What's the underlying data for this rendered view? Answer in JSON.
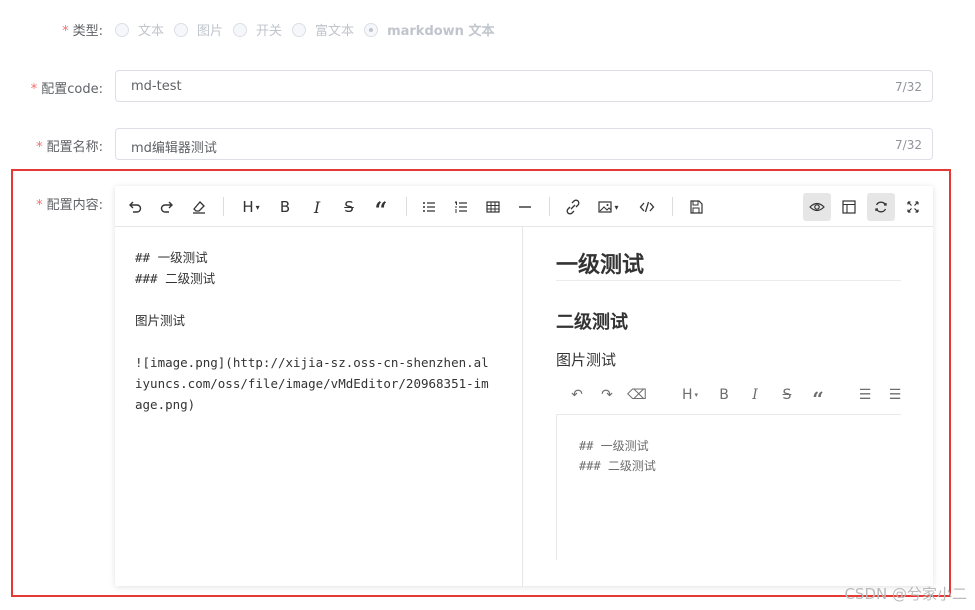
{
  "form": {
    "type_field": {
      "label": "类型:",
      "required_mark": "*",
      "options": [
        {
          "label": "文本",
          "checked": false
        },
        {
          "label": "图片",
          "checked": false
        },
        {
          "label": "开关",
          "checked": false
        },
        {
          "label": "富文本",
          "checked": false
        },
        {
          "label": "markdown 文本",
          "checked": true
        }
      ]
    },
    "code_field": {
      "label": "配置code:",
      "required_mark": "*",
      "value": "md-test",
      "count": "7/32"
    },
    "name_field": {
      "label": "配置名称:",
      "required_mark": "*",
      "value": "md编辑器测试",
      "count": "7/32"
    },
    "content_field": {
      "label": "配置内容:",
      "required_mark": "*"
    }
  },
  "editor": {
    "toolbar": {
      "undo": "undo-icon",
      "redo": "redo-icon",
      "clear": "eraser-icon",
      "heading": "H",
      "bold": "B",
      "italic": "I",
      "strikethrough": "S",
      "quote": "“",
      "table": "table-icon"
    },
    "source_lines": [
      "## 一级测试",
      "### 二级测试",
      "",
      "图片测试",
      "",
      "![image.png](http://xijia-sz.oss-cn-shenzhen.al",
      "iyuncs.com/oss/file/image/vMdEditor/20968351-im",
      "age.png)"
    ],
    "preview": {
      "h2": "一级测试",
      "h3": "二级测试",
      "paragraph": "图片测试",
      "image_lines": [
        "## 一级测试",
        "### 二级测试"
      ]
    }
  },
  "watermark": "CSDN @兮家小二"
}
